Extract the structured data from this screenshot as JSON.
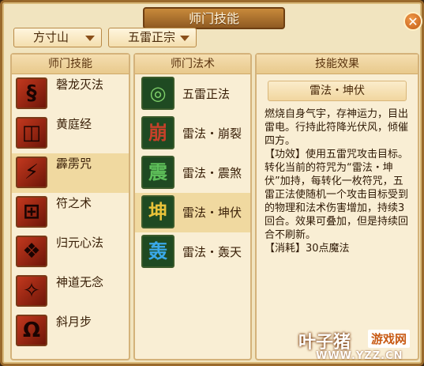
{
  "window": {
    "title": "师门技能",
    "close_glyph": "✕"
  },
  "filters": {
    "sect": "方寸山",
    "school": "五雷正宗"
  },
  "skills_panel": {
    "header": "师门技能",
    "items": [
      {
        "label": "磬龙灭法",
        "icon": "dragon-coil-icon",
        "glyph": "§"
      },
      {
        "label": "黄庭经",
        "icon": "scripture-icon",
        "glyph": "◫"
      },
      {
        "label": "霹雳咒",
        "icon": "thunder-rune-icon",
        "glyph": "⚡"
      },
      {
        "label": "符之术",
        "icon": "talisman-icon",
        "glyph": "⊞"
      },
      {
        "label": "归元心法",
        "icon": "heart-method-icon",
        "glyph": "❖"
      },
      {
        "label": "神道无念",
        "icon": "divine-path-icon",
        "glyph": "✧"
      },
      {
        "label": "斜月步",
        "icon": "moon-step-icon",
        "glyph": "Ω"
      }
    ],
    "selected_index": 2
  },
  "spells_panel": {
    "header": "师门法术",
    "items": [
      {
        "label": "五雷正法",
        "icon": "five-thunder-icon",
        "glyph": "◎",
        "color": "#7fd06a"
      },
      {
        "label": "雷法・崩裂",
        "icon": "thunder-split-icon",
        "glyph": "崩",
        "color": "#c7402a"
      },
      {
        "label": "雷法・震煞",
        "icon": "thunder-quake-icon",
        "glyph": "震",
        "color": "#5ec05a"
      },
      {
        "label": "雷法・坤伏",
        "icon": "thunder-kun-icon",
        "glyph": "坤",
        "color": "#e8c23a"
      },
      {
        "label": "雷法・轰天",
        "icon": "thunder-sky-icon",
        "glyph": "轰",
        "color": "#3aa8e8"
      }
    ],
    "selected_index": 3
  },
  "effect_panel": {
    "header": "技能效果",
    "title": "雷法・坤伏",
    "paragraphs": [
      "燃烧自身气宇，存神运力，目出雷电。行持此符降光伏风，倾催四方。",
      "【功效】使用五雷咒攻击目标。转化当前的符咒为“雷法・坤伏”加持，每转化一枚符咒，五雷正法使随机一个攻击目标受到的物理和法术伤害增加，持续3回合。效果可叠加，但是持续回合不刷新。",
      "【消耗】30点魔法"
    ]
  },
  "watermark": {
    "brand": "叶子猪",
    "box": "游戏网",
    "url": "WWW.YZZ.CN"
  },
  "colors": {
    "panel_bg": "#f9eed4",
    "selected_bg": "#f0d9a0",
    "border": "#9a6a2c",
    "accent": "#c25a13"
  }
}
